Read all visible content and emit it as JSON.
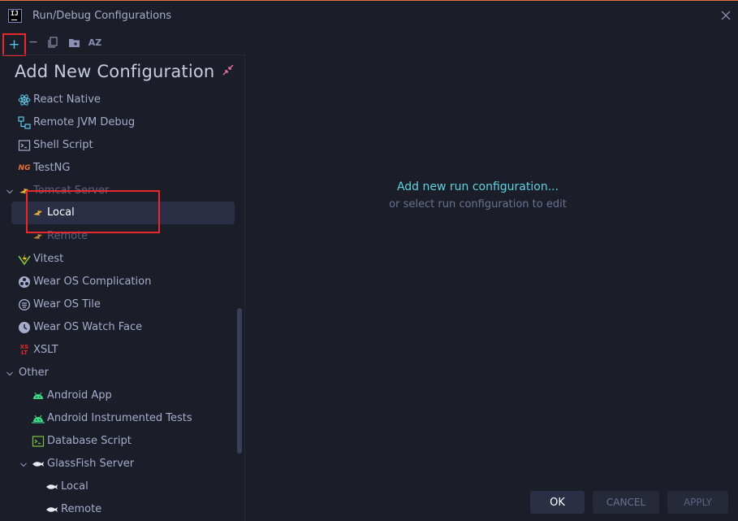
{
  "window": {
    "title": "Run/Debug Configurations",
    "app_icon_text": "IJ"
  },
  "toolbar": {
    "add_icon": "+",
    "remove_icon": "−",
    "sort_icon": "AZ"
  },
  "left_panel": {
    "header": "Add New Configuration",
    "items": [
      {
        "label": "React Native",
        "icon": "react-icon"
      },
      {
        "label": "Remote JVM Debug",
        "icon": "remote-debug-icon"
      },
      {
        "label": "Shell Script",
        "icon": "terminal-icon"
      },
      {
        "label": "TestNG",
        "icon": "testng-icon"
      },
      {
        "label": "Tomcat Server",
        "icon": "tomcat-icon"
      },
      {
        "label": "Local",
        "icon": "tomcat-icon"
      },
      {
        "label": "Remote",
        "icon": "tomcat-icon"
      },
      {
        "label": "Vitest",
        "icon": "vitest-icon"
      },
      {
        "label": "Wear OS Complication",
        "icon": "wear-complication-icon"
      },
      {
        "label": "Wear OS Tile",
        "icon": "wear-tile-icon"
      },
      {
        "label": "Wear OS Watch Face",
        "icon": "clock-icon"
      },
      {
        "label": "XSLT",
        "icon": "xslt-icon"
      },
      {
        "label": "Other",
        "icon": "chevron-down-icon"
      },
      {
        "label": "Android App",
        "icon": "android-icon"
      },
      {
        "label": "Android Instrumented Tests",
        "icon": "android-test-icon"
      },
      {
        "label": "Database Script",
        "icon": "terminal-icon"
      },
      {
        "label": "GlassFish Server",
        "icon": "glassfish-icon"
      },
      {
        "label": "Local",
        "icon": "glassfish-icon"
      },
      {
        "label": "Remote",
        "icon": "glassfish-icon"
      }
    ],
    "testng_badge": "NG",
    "xslt_badge_top": "XS",
    "xslt_badge_bottom": "LT"
  },
  "right_panel": {
    "link_text": "Add new run configuration...",
    "hint_text": "or select run configuration to edit"
  },
  "buttons": {
    "ok": "OK",
    "cancel": "CANCEL",
    "apply": "APPLY"
  },
  "colors": {
    "accent": "#5fd3e0",
    "highlight_border": "#e8282b",
    "background": "#1b1e28",
    "selection": "#2a2f45"
  }
}
